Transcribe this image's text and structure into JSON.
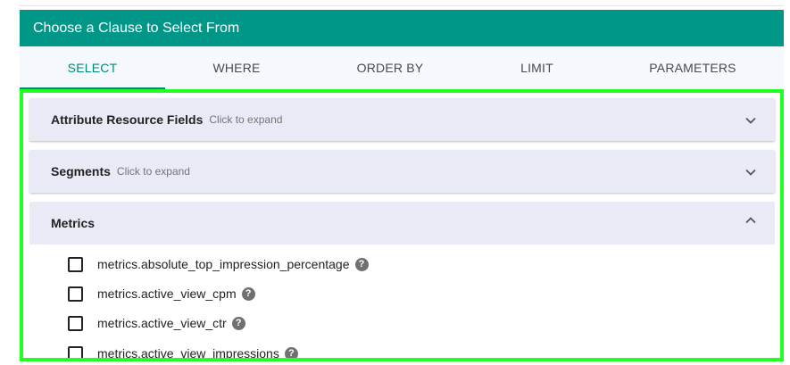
{
  "header": {
    "title": "Choose a Clause to Select From"
  },
  "tabs": [
    {
      "label": "SELECT",
      "active": true
    },
    {
      "label": "WHERE",
      "active": false
    },
    {
      "label": "ORDER BY",
      "active": false
    },
    {
      "label": "LIMIT",
      "active": false
    },
    {
      "label": "PARAMETERS",
      "active": false
    }
  ],
  "accordions": [
    {
      "title": "Attribute Resource Fields",
      "hint": "Click to expand",
      "expanded": false,
      "chevron": "chevron-down-icon"
    },
    {
      "title": "Segments",
      "hint": "Click to expand",
      "expanded": false,
      "chevron": "chevron-down-icon"
    },
    {
      "title": "Metrics",
      "hint": "",
      "expanded": true,
      "chevron": "chevron-up-icon"
    }
  ],
  "metrics": {
    "items": [
      {
        "label": "metrics.absolute_top_impression_percentage",
        "checked": false
      },
      {
        "label": "metrics.active_view_cpm",
        "checked": false
      },
      {
        "label": "metrics.active_view_ctr",
        "checked": false
      },
      {
        "label": "metrics.active_view_impressions",
        "checked": false
      }
    ],
    "help_glyph": "?"
  },
  "colors": {
    "header_bg": "#009688",
    "accent": "#00897b",
    "highlight_border": "#22ff22",
    "accordion_bg": "#e8eaf6"
  }
}
